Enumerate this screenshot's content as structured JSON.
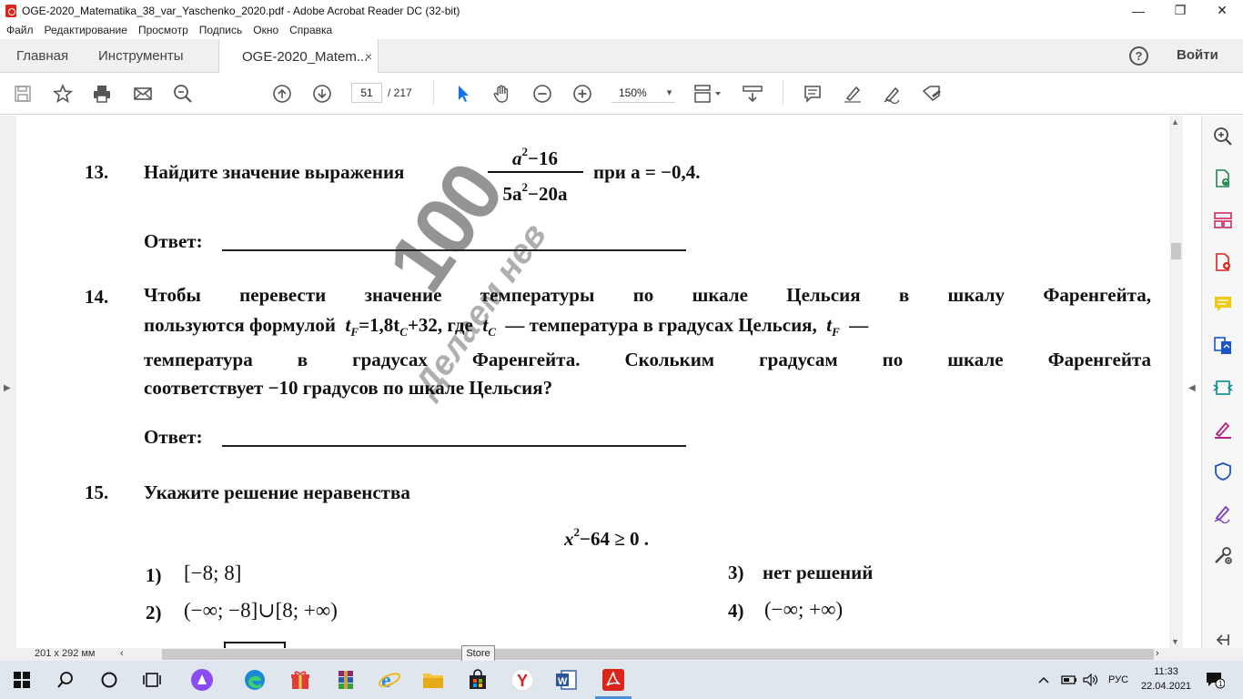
{
  "window": {
    "title": "OGE-2020_Matematika_38_var_Yaschenko_2020.pdf - Adobe Acrobat Reader DC (32-bit)",
    "minimize": "—",
    "restore": "❐",
    "close": "✕"
  },
  "menu": [
    "Файл",
    "Редактирование",
    "Просмотр",
    "Подпись",
    "Окно",
    "Справка"
  ],
  "tabs": {
    "home": "Главная",
    "tools": "Инструменты",
    "doc": "OGE-2020_Matem...",
    "close": "×",
    "help": "?",
    "signin": "Войти"
  },
  "toolbar": {
    "page_current": "51",
    "page_total": "/ 217",
    "zoom": "150%",
    "zoom_arrow": "▾"
  },
  "document": {
    "watermark_big": "100",
    "watermark_text": "Делаем нев",
    "q13": {
      "num": "13.",
      "text": "Найдите значение выражения",
      "numerator_base": "a",
      "numerator_exp": "2",
      "numerator_rest": "−16",
      "denominator_pre": "5a",
      "denominator_exp": "2",
      "denominator_rest": "−20a",
      "tail": "при a = −0,4."
    },
    "answer_label": "Ответ:",
    "q14": {
      "num": "14.",
      "line1": "Чтобы перевести значение температуры по шкале Цельсия в шкалу Фаренгейта,",
      "line2_a": "пользуются формулой",
      "formula_t": "t",
      "formula_F": "F",
      "formula_mid": "=1,8t",
      "formula_C": "C",
      "formula_end": "+32",
      "line2_b": ", где",
      "tC_t": "t",
      "tC_C": "C",
      "line2_c": "— температура в градусах Цельсия,",
      "tF_t": "t",
      "tF_F": "F",
      "line2_d": "—",
      "line3": "температура в градусах Фаренгейта. Скольким градусам по шкале Фаренгейта",
      "line4": "соответствует −10 градусов по шкале Цельсия?"
    },
    "q15": {
      "num": "15.",
      "text": "Укажите решение неравенства",
      "ineq_x": "x",
      "ineq_exp": "2",
      "ineq_rest": "−64 ≥ 0 .",
      "opt1_n": "1)",
      "opt1": "[−8; 8]",
      "opt2_n": "2)",
      "opt2": "(−∞; −8]∪[8; +∞)",
      "opt3_n": "3)",
      "opt3": "нет решений",
      "opt4_n": "4)",
      "opt4": "(−∞; +∞)"
    }
  },
  "status": {
    "dimensions": "201 x 292 мм",
    "tooltip": "Store"
  },
  "taskbar": {
    "lang": "РУС",
    "time": "11:33",
    "date": "22.04.2021",
    "notif": "1"
  },
  "colors": {
    "acrobat_red": "#d9251c",
    "select_blue": "#1473e6",
    "taskbar_bg": "#dfe6ee"
  }
}
